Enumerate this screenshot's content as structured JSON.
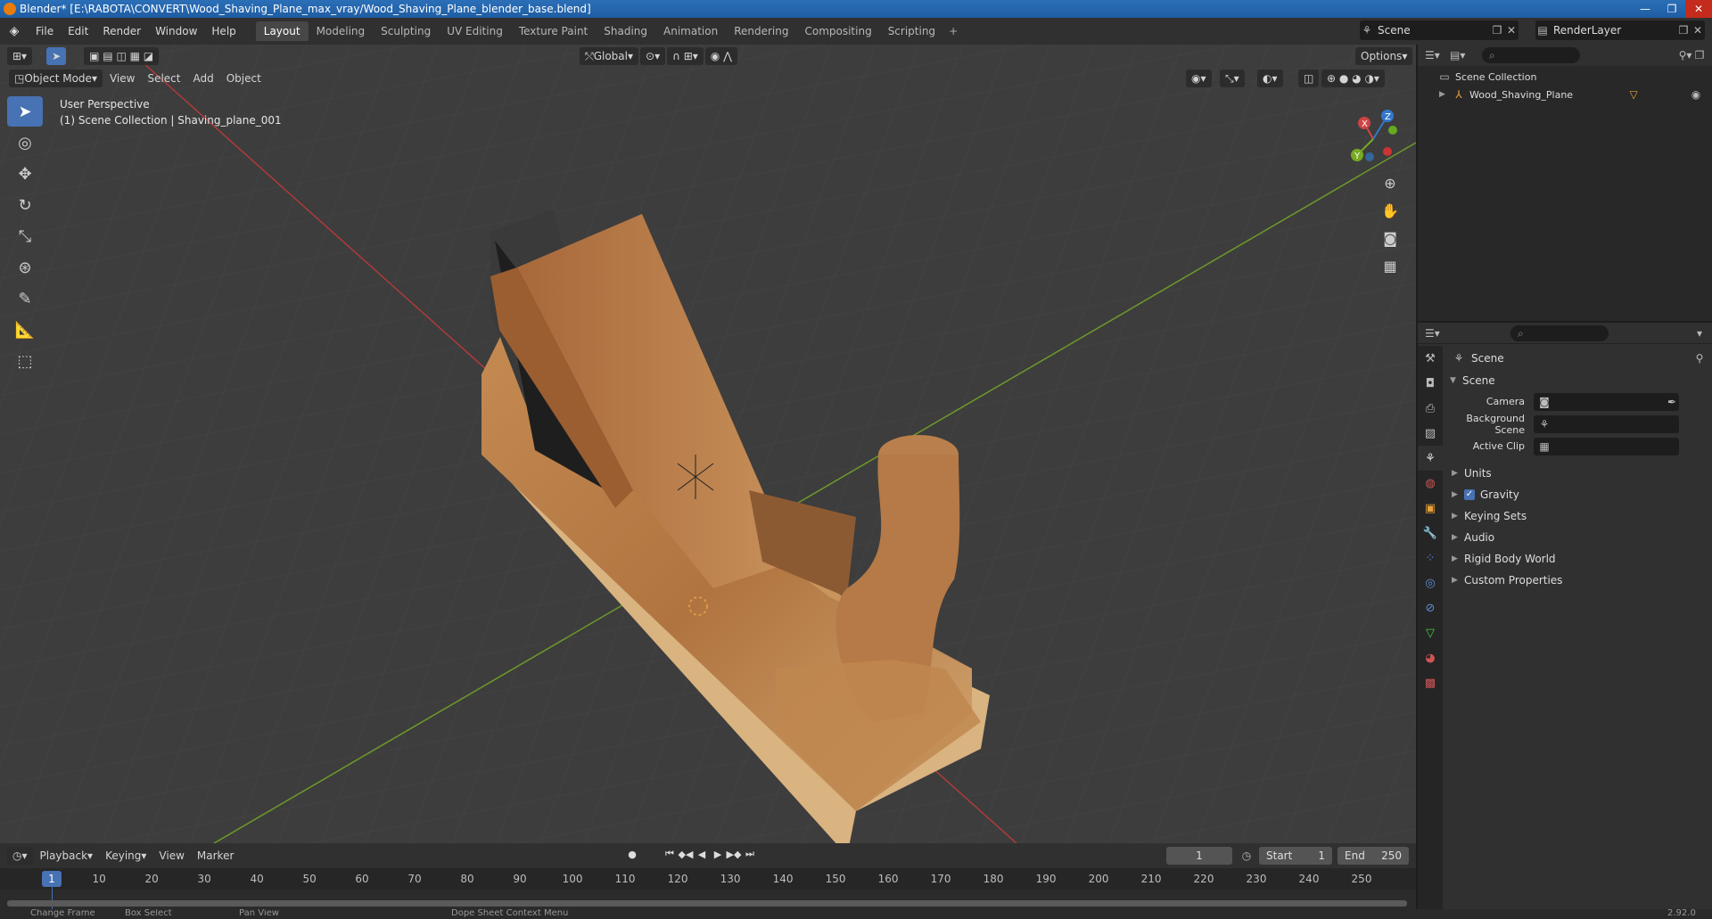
{
  "window": {
    "title": "Blender* [E:\\RABOTA\\CONVERT\\Wood_Shaving_Plane_max_vray/Wood_Shaving_Plane_blender_base.blend]",
    "minimize": "—",
    "maximize": "❐",
    "close": "✕"
  },
  "menu": [
    "File",
    "Edit",
    "Render",
    "Window",
    "Help"
  ],
  "workspaces": [
    "Layout",
    "Modeling",
    "Sculpting",
    "UV Editing",
    "Texture Paint",
    "Shading",
    "Animation",
    "Rendering",
    "Compositing",
    "Scripting"
  ],
  "active_workspace": "Layout",
  "scene_selector": "Scene",
  "render_layer": "RenderLayer",
  "viewport": {
    "orientation": "Global",
    "options_label": "Options",
    "mode": "Object Mode",
    "menus": [
      "View",
      "Select",
      "Add",
      "Object"
    ],
    "info_line1": "User Perspective",
    "info_line2": "(1) Scene Collection | Shaving_plane_001",
    "gizmo_axes": {
      "x": "X",
      "y": "Y",
      "z": "Z"
    },
    "colors": {
      "background": "#3d3d3d",
      "x_axis": "#c23a3a",
      "y_axis": "#7aa82c",
      "accent": "#4772b3"
    }
  },
  "outliner": {
    "root": "Scene Collection",
    "items": [
      {
        "label": "Wood_Shaving_Plane"
      }
    ]
  },
  "properties": {
    "context_title": "Scene",
    "section": "Scene",
    "fields": [
      {
        "label": "Camera",
        "value": ""
      },
      {
        "label": "Background Scene",
        "value": ""
      },
      {
        "label": "Active Clip",
        "value": ""
      }
    ],
    "subsections": [
      {
        "label": "Units",
        "checkbox": false
      },
      {
        "label": "Gravity",
        "checkbox": true
      },
      {
        "label": "Keying Sets",
        "checkbox": false
      },
      {
        "label": "Audio",
        "checkbox": false
      },
      {
        "label": "Rigid Body World",
        "checkbox": false
      },
      {
        "label": "Custom Properties",
        "checkbox": false
      }
    ]
  },
  "timeline": {
    "menus": [
      "Playback",
      "Keying",
      "View",
      "Marker"
    ],
    "current_frame": "1",
    "start_label": "Start",
    "start": "1",
    "end_label": "End",
    "end": "250",
    "ticks": [
      "1",
      "10",
      "20",
      "30",
      "40",
      "50",
      "60",
      "70",
      "80",
      "90",
      "100",
      "110",
      "120",
      "130",
      "140",
      "150",
      "160",
      "170",
      "180",
      "190",
      "200",
      "210",
      "220",
      "230",
      "240",
      "250"
    ]
  },
  "statusbar": {
    "items": [
      "Change Frame",
      "Box Select",
      "Pan View",
      "Dope Sheet Context Menu"
    ],
    "version": "2.92.0"
  }
}
